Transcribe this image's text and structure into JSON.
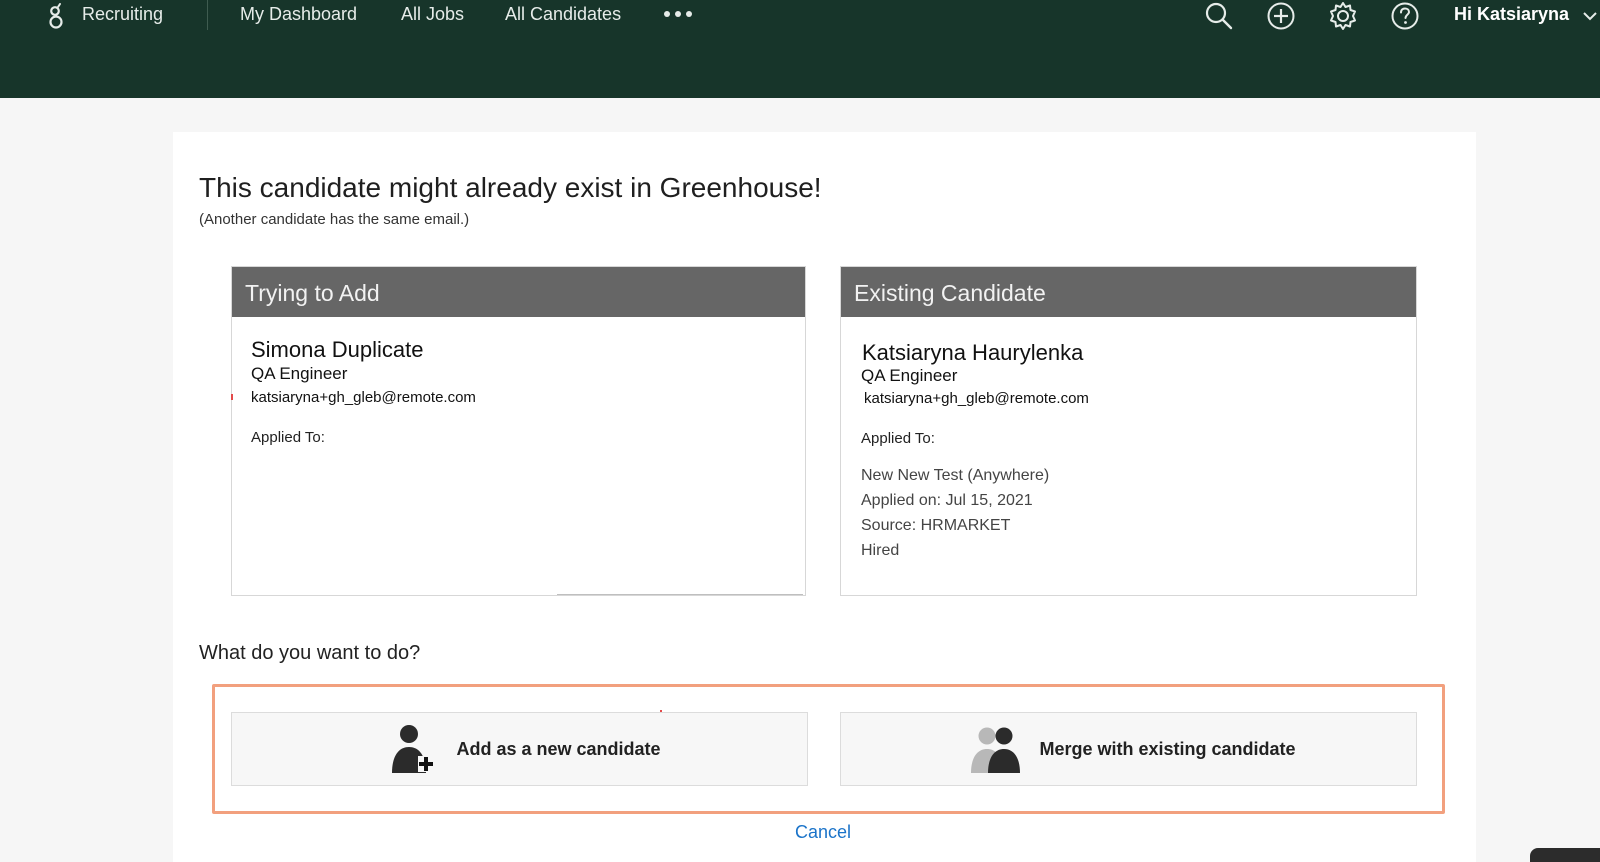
{
  "nav": {
    "brand": "Recruiting",
    "links": [
      "My Dashboard",
      "All Jobs",
      "All Candidates"
    ],
    "more_icon": "ellipsis-icon",
    "icons": [
      "search-icon",
      "add-circle-icon",
      "gear-icon",
      "help-circle-icon"
    ],
    "greeting": "Hi Katsiaryna",
    "background_color": "#17352a"
  },
  "page": {
    "title": "This candidate might already exist in Greenhouse!",
    "subtitle": "(Another candidate has the same email.)"
  },
  "trying_to_add": {
    "heading": "Trying to Add",
    "name": "Simona Duplicate",
    "job_title": "QA Engineer",
    "email": "katsiaryna+gh_gleb@remote.com",
    "applied_to_label": "Applied To:"
  },
  "existing_candidate": {
    "heading": "Existing Candidate",
    "name": "Katsiaryna Haurylenka",
    "job_title": "QA Engineer",
    "email": "katsiaryna+gh_gleb@remote.com",
    "applied_to_label": "Applied To:",
    "application": {
      "job": "New New Test (Anywhere)",
      "applied_on": "Applied on: Jul 15, 2021",
      "source": "Source: HRMARKET",
      "status": "Hired"
    }
  },
  "actions": {
    "question": "What do you want to do?",
    "add_label": "Add as a new candidate",
    "add_icon": "add-person-icon",
    "merge_label": "Merge with existing candidate",
    "merge_icon": "people-merge-icon",
    "cancel_label": "Cancel",
    "highlight_color": "#f2a07e",
    "link_color": "#1a73c9"
  }
}
